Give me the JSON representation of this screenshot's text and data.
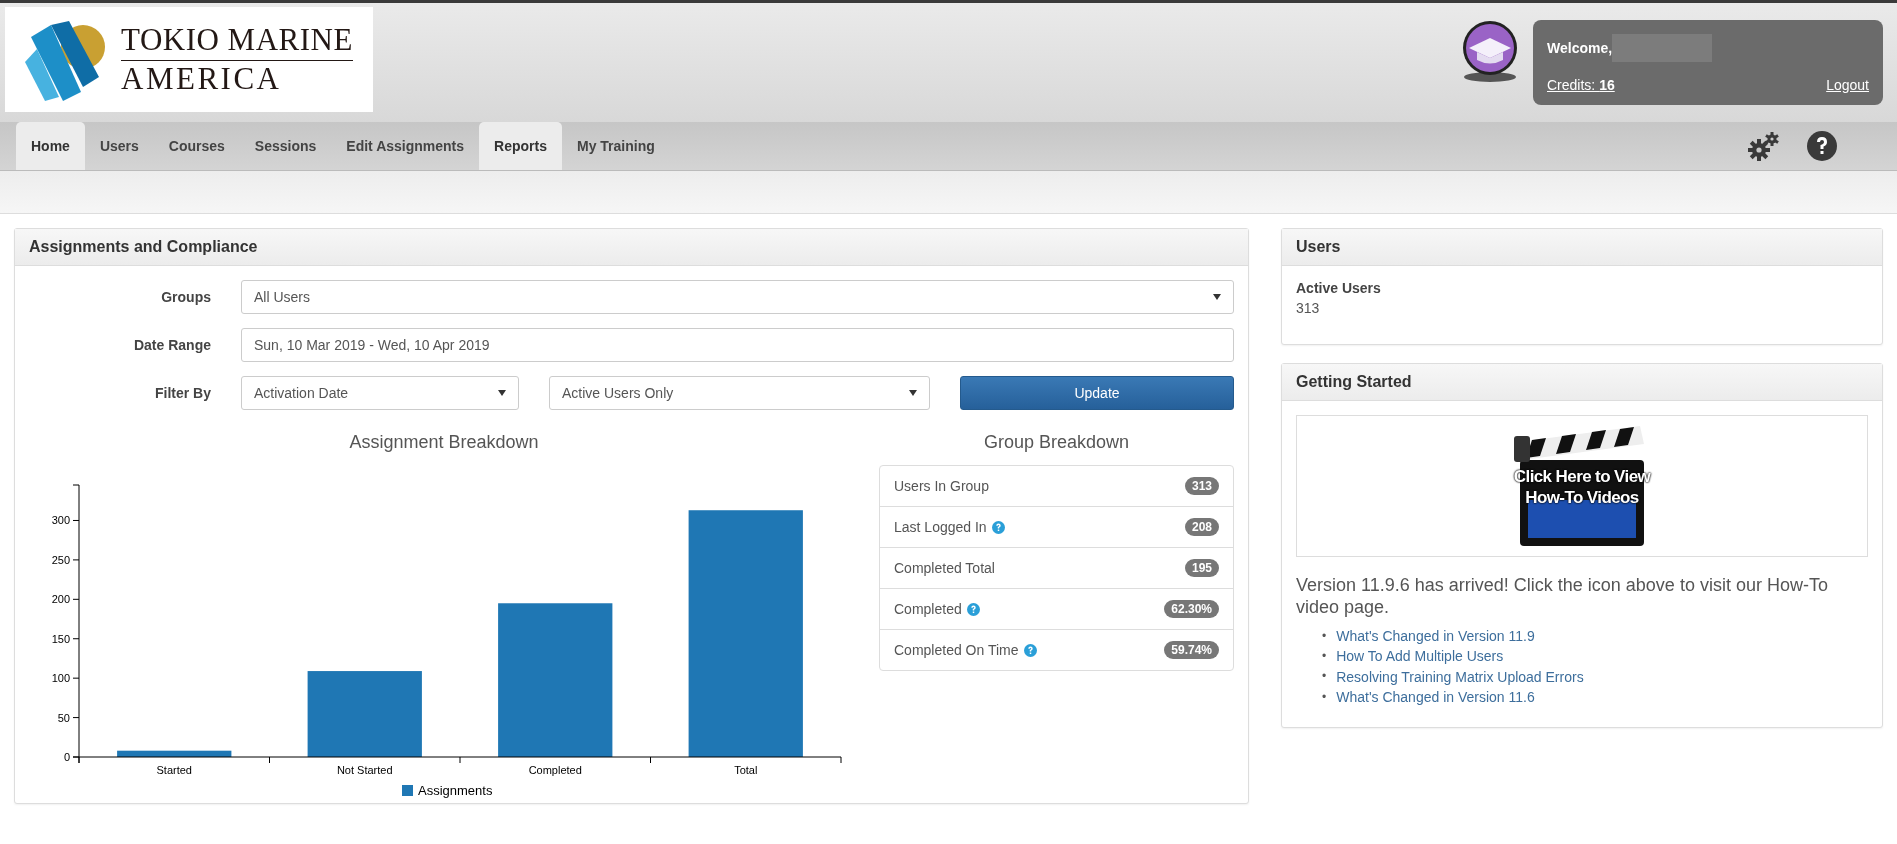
{
  "logo": {
    "line1": "TOKIO MARINE",
    "line2": "AMERICA"
  },
  "account": {
    "welcome": "Welcome,",
    "credits_label": "Credits:",
    "credits": "16",
    "logout": "Logout"
  },
  "tabs": [
    {
      "label": "Home",
      "selected": true
    },
    {
      "label": "Users",
      "selected": false
    },
    {
      "label": "Courses",
      "selected": false
    },
    {
      "label": "Sessions",
      "selected": false
    },
    {
      "label": "Edit Assignments",
      "selected": false
    },
    {
      "label": "Reports",
      "selected": true
    },
    {
      "label": "My Training",
      "selected": false
    }
  ],
  "assignments_panel": {
    "title": "Assignments and Compliance",
    "groups": {
      "label": "Groups",
      "value": "All Users"
    },
    "date_range": {
      "label": "Date Range",
      "value": "Sun, 10 Mar 2019 - Wed, 10 Apr 2019"
    },
    "filter": {
      "label": "Filter By",
      "value_1": "Activation Date",
      "value_2": "Active Users Only"
    },
    "update_button": "Update",
    "chart_data": {
      "type": "bar",
      "title": "Assignment Breakdown",
      "categories": [
        "Started",
        "Not Started",
        "Completed",
        "Total"
      ],
      "series": [
        {
          "name": "Assignments",
          "color": "#1f77b4",
          "values": [
            8,
            109,
            195,
            313
          ]
        }
      ],
      "ylim": [
        0,
        345
      ],
      "yticks": [
        0,
        50,
        100,
        150,
        200,
        250,
        300
      ]
    },
    "group_breakdown": {
      "title": "Group Breakdown",
      "rows": [
        {
          "label": "Users In Group",
          "help": false,
          "value": "313"
        },
        {
          "label": "Last Logged In",
          "help": true,
          "value": "208"
        },
        {
          "label": "Completed Total",
          "help": false,
          "value": "195"
        },
        {
          "label": "Completed",
          "help": true,
          "value": "62.30%"
        },
        {
          "label": "Completed On Time",
          "help": true,
          "value": "59.74%"
        }
      ]
    }
  },
  "users_panel": {
    "title": "Users",
    "label": "Active Users",
    "value": "313"
  },
  "getting_started": {
    "title": "Getting Started",
    "banner_lines": [
      "Click Here to View",
      "How-To Videos"
    ],
    "bullet": "•",
    "message": "Version 11.9.6 has arrived! Click the icon above to visit our How-To video page.",
    "links": [
      "What's Changed in Version 11.9",
      "How To Add Multiple Users",
      "Resolving Training Matrix Upload Errors",
      "What's Changed in Version 11.6"
    ]
  }
}
